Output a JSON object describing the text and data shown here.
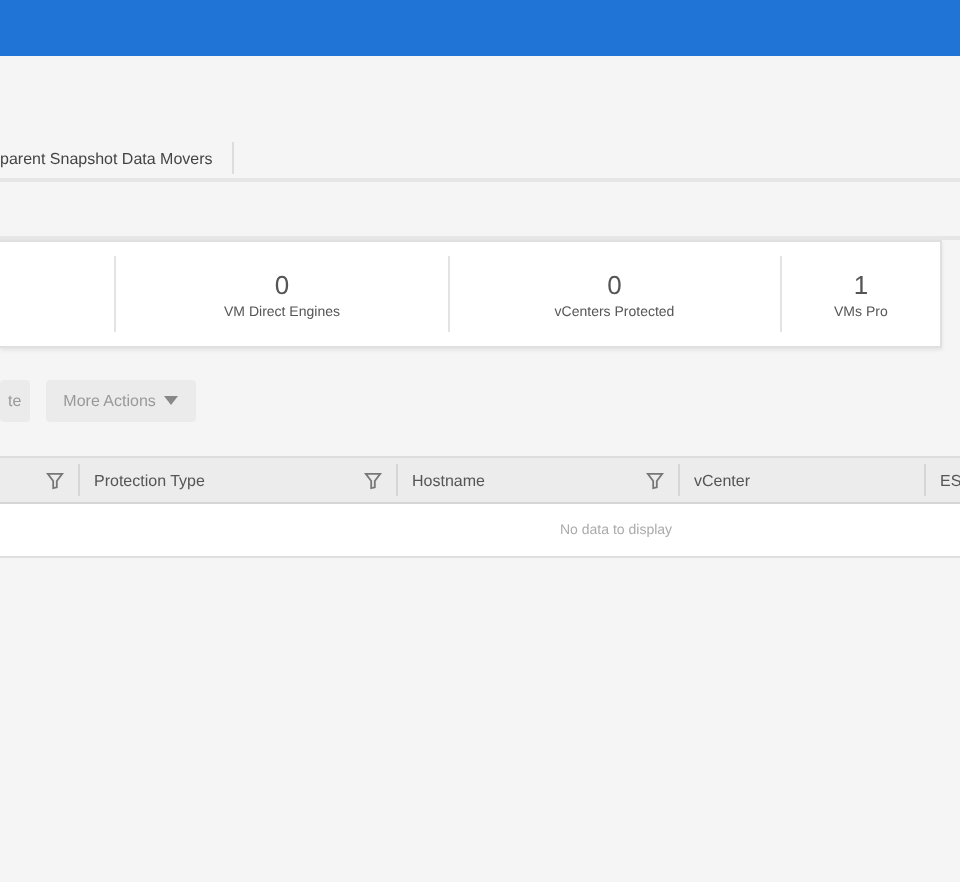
{
  "tabs": [
    {
      "label": "parent Snapshot Data Movers",
      "selected": false
    }
  ],
  "stats": [
    {
      "value": "0",
      "label": "VM Direct Engines"
    },
    {
      "value": "0",
      "label": "vCenters Protected"
    },
    {
      "value": "1",
      "label": "VMs Pro"
    }
  ],
  "actions": [
    {
      "label": "te",
      "caret": false
    },
    {
      "label": "More Actions",
      "caret": true
    }
  ],
  "table": {
    "columns": [
      {
        "filter": true
      },
      {
        "label": "Protection Type",
        "filter": true
      },
      {
        "label": "Hostname",
        "filter": true
      },
      {
        "label": "vCenter",
        "filter": false
      },
      {
        "label": "ES",
        "filter": false
      }
    ],
    "empty_message": "No data to display"
  }
}
